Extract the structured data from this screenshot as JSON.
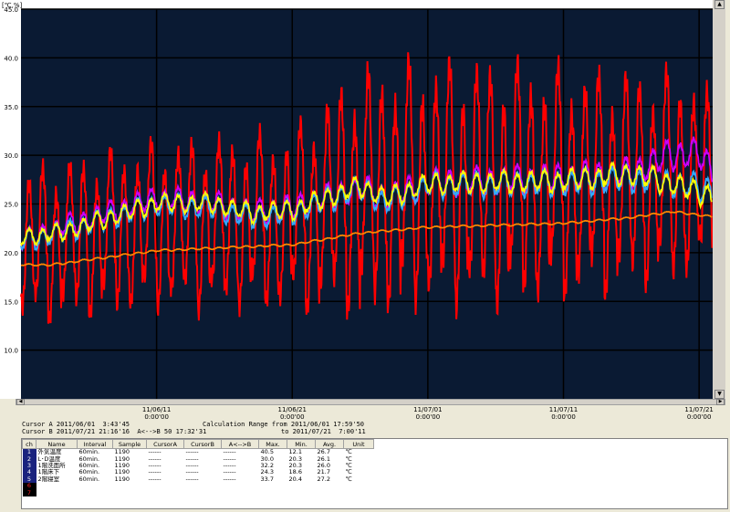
{
  "y_unit_label": "[℃,%]",
  "cursor_a": "Cursor A 2011/06/01  3:43'45",
  "cursor_b": "Cursor B 2011/07/21 21:16'16  A<-->B 50 17:32'31",
  "calc_range_from": "Calculation Range from 2011/06/01 17:59'50",
  "calc_range_to": "to 2011/07/21  7:00'11",
  "table": {
    "headers": [
      "ch",
      "Name",
      "Interval",
      "Sample",
      "CursorA",
      "CursorB",
      "A<-->B",
      "Max.",
      "Min.",
      "Avg.",
      "Unit"
    ],
    "rows": [
      {
        "ch": "1",
        "name": "外気温度",
        "interval": "60min.",
        "sample": "1190",
        "ca": "------",
        "cb": "------",
        "ab": "------",
        "max": "40.5",
        "min": "12.1",
        "avg": "26.7",
        "unit": "℃",
        "color": "#ff0000"
      },
      {
        "ch": "2",
        "name": "L･D温度",
        "interval": "60min.",
        "sample": "1190",
        "ca": "------",
        "cb": "------",
        "ab": "------",
        "max": "30.0",
        "min": "20.3",
        "avg": "26.1",
        "unit": "℃",
        "color": "#ffff00"
      },
      {
        "ch": "3",
        "name": "1階洗面所",
        "interval": "60min.",
        "sample": "1190",
        "ca": "------",
        "cb": "------",
        "ab": "------",
        "max": "32.2",
        "min": "20.3",
        "avg": "26.0",
        "unit": "℃",
        "color": "#33aaff"
      },
      {
        "ch": "4",
        "name": "1階床下",
        "interval": "60min.",
        "sample": "1190",
        "ca": "------",
        "cb": "------",
        "ab": "------",
        "max": "24.3",
        "min": "18.6",
        "avg": "21.7",
        "unit": "℃",
        "color": "#ff8800"
      },
      {
        "ch": "5",
        "name": "2階寝室",
        "interval": "60min.",
        "sample": "1190",
        "ca": "------",
        "cb": "------",
        "ab": "------",
        "max": "33.7",
        "min": "20.4",
        "avg": "27.2",
        "unit": "℃",
        "color": "#cc00ff"
      },
      {
        "ch": "6",
        "name": "",
        "interval": "",
        "sample": "",
        "ca": "",
        "cb": "",
        "ab": "",
        "max": "",
        "min": "",
        "avg": "",
        "unit": "",
        "color": "#000000"
      },
      {
        "ch": "7",
        "name": "",
        "interval": "",
        "sample": "",
        "ca": "",
        "cb": "",
        "ab": "",
        "max": "",
        "min": "",
        "avg": "",
        "unit": "",
        "color": "#000000"
      }
    ]
  },
  "chart_data": {
    "type": "line",
    "ylim": [
      5,
      45
    ],
    "yticks": [
      "10.0",
      "15.0",
      "20.0",
      "25.0",
      "30.0",
      "35.0",
      "40.0",
      "45.0"
    ],
    "xlim_days": [
      0,
      51
    ],
    "xticks": [
      {
        "date": "11/06/11",
        "time": "0:00'00",
        "day": 10
      },
      {
        "date": "11/06/21",
        "time": "0:00'00",
        "day": 20
      },
      {
        "date": "11/07/01",
        "time": "0:00'00",
        "day": 30
      },
      {
        "date": "11/07/11",
        "time": "0:00'00",
        "day": 40
      },
      {
        "date": "11/07/21",
        "time": "0:00'00",
        "day": 50
      }
    ],
    "grid": true,
    "series": [
      {
        "name": "外気温度",
        "color": "#ff0000",
        "base": [
          [
            0,
            20
          ],
          [
            10,
            22
          ],
          [
            20,
            22.5
          ],
          [
            24,
            25
          ],
          [
            30,
            26
          ],
          [
            40,
            26
          ],
          [
            50,
            27
          ],
          [
            51,
            24
          ]
        ],
        "amp": [
          [
            0,
            7
          ],
          [
            20,
            8
          ],
          [
            25,
            11
          ],
          [
            35,
            11
          ],
          [
            51,
            9
          ]
        ]
      },
      {
        "name": "2階寝室",
        "color": "#cc00ff",
        "base": [
          [
            0,
            21
          ],
          [
            3,
            22.5
          ],
          [
            10,
            25.5
          ],
          [
            14,
            25
          ],
          [
            17,
            24
          ],
          [
            20,
            24.5
          ],
          [
            25,
            26.5
          ],
          [
            27,
            25.5
          ],
          [
            30,
            27
          ],
          [
            40,
            27.5
          ],
          [
            45,
            28
          ],
          [
            48,
            30
          ],
          [
            50,
            30
          ],
          [
            51,
            28
          ]
        ],
        "amp": [
          [
            0,
            1
          ],
          [
            51,
            1.5
          ]
        ]
      },
      {
        "name": "1階洗面所",
        "color": "#33aaff",
        "base": [
          [
            0,
            21
          ],
          [
            3,
            22
          ],
          [
            10,
            24.8
          ],
          [
            14,
            24.5
          ],
          [
            17,
            23.5
          ],
          [
            20,
            24
          ],
          [
            25,
            26.5
          ],
          [
            27,
            25
          ],
          [
            30,
            26.8
          ],
          [
            40,
            27
          ],
          [
            45,
            27.5
          ],
          [
            48,
            27
          ],
          [
            50,
            26.5
          ],
          [
            51,
            26.5
          ]
        ],
        "amp": [
          [
            0,
            1
          ],
          [
            51,
            1.3
          ]
        ]
      },
      {
        "name": "L･D温度",
        "color": "#ffff00",
        "base": [
          [
            0,
            21.5
          ],
          [
            3,
            22
          ],
          [
            10,
            25
          ],
          [
            14,
            25
          ],
          [
            17,
            24
          ],
          [
            20,
            24.3
          ],
          [
            25,
            26.7
          ],
          [
            27,
            25.5
          ],
          [
            30,
            27
          ],
          [
            40,
            27.3
          ],
          [
            45,
            28
          ],
          [
            48,
            27
          ],
          [
            50,
            26
          ],
          [
            51,
            26
          ]
        ],
        "amp": [
          [
            0,
            0.8
          ],
          [
            51,
            1.1
          ]
        ]
      },
      {
        "name": "1階床下",
        "color": "#ff8800",
        "base": [
          [
            0,
            18.8
          ],
          [
            2,
            18.7
          ],
          [
            10,
            20.2
          ],
          [
            20,
            20.8
          ],
          [
            25,
            22
          ],
          [
            30,
            22.6
          ],
          [
            40,
            23
          ],
          [
            45,
            23.6
          ],
          [
            48,
            24.2
          ],
          [
            51,
            23.7
          ]
        ],
        "amp": [
          [
            0,
            0.1
          ],
          [
            51,
            0.1
          ]
        ]
      }
    ]
  }
}
